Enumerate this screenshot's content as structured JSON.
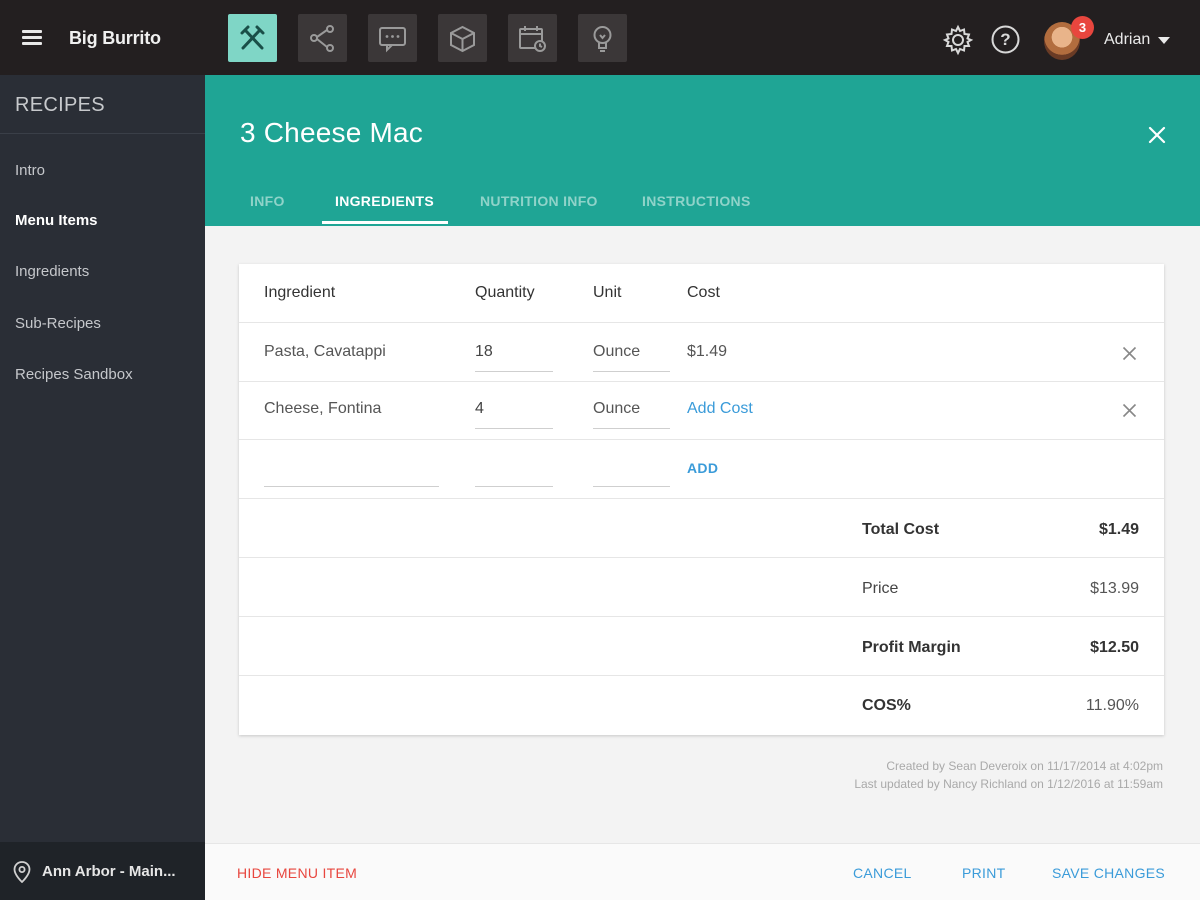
{
  "topbar": {
    "brand": "Big Burrito",
    "nav_icons": [
      "recipes-icon",
      "network-icon",
      "messages-icon",
      "inventory-icon",
      "schedule-icon",
      "lightbulb-icon"
    ],
    "active_nav": "recipes-icon",
    "notification_count": "3",
    "user_name": "Adrian"
  },
  "sidebar": {
    "title": "RECIPES",
    "items": [
      {
        "label": "Intro",
        "active": false
      },
      {
        "label": "Menu Items",
        "active": true
      },
      {
        "label": "Ingredients",
        "active": false
      },
      {
        "label": "Sub-Recipes",
        "active": false
      },
      {
        "label": "Recipes Sandbox",
        "active": false
      }
    ],
    "location": "Ann Arbor - Main..."
  },
  "header": {
    "title": "3 Cheese Mac",
    "tabs": [
      {
        "label": "INFO",
        "active": false
      },
      {
        "label": "INGREDIENTS",
        "active": true
      },
      {
        "label": "NUTRITION INFO",
        "active": false
      },
      {
        "label": "INSTRUCTIONS",
        "active": false
      }
    ]
  },
  "table": {
    "columns": [
      "Ingredient",
      "Quantity",
      "Unit",
      "Cost"
    ],
    "rows": [
      {
        "ingredient": "Pasta, Cavatappi",
        "quantity": "18",
        "unit": "Ounce",
        "cost": "$1.49"
      },
      {
        "ingredient": "Cheese, Fontina",
        "quantity": "4",
        "unit": "Ounce",
        "cost": "Add Cost"
      }
    ],
    "add_label": "ADD"
  },
  "summary": [
    {
      "label": "Total Cost",
      "value": "$1.49"
    },
    {
      "label": "Price",
      "value": "$13.99"
    },
    {
      "label": "Profit Margin",
      "value": "$12.50"
    },
    {
      "label": "COS%",
      "value": "11.90%"
    }
  ],
  "meta": {
    "created": "Created by Sean Deveroix on 11/17/2014 at 4:02pm",
    "updated": "Last updated by Nancy Richland on 1/12/2016 at 11:59am"
  },
  "footer": {
    "hide_label": "HIDE MENU ITEM",
    "cancel_label": "CANCEL",
    "print_label": "PRINT",
    "save_label": "SAVE CHANGES"
  },
  "colors": {
    "accent": "#1fa595",
    "link": "#3a9bd9",
    "danger": "#e8463e",
    "sidebar": "#2a2e36",
    "topbar": "#231f20"
  }
}
